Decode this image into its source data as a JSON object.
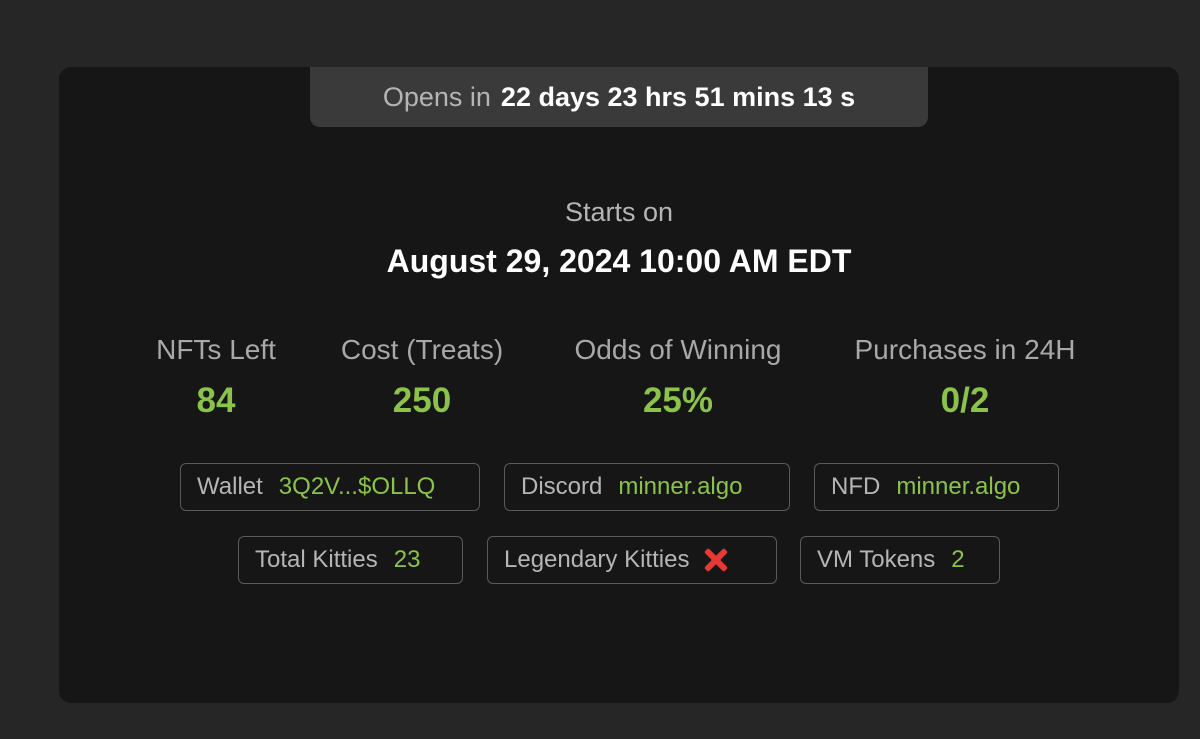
{
  "countdown": {
    "prefix": "Opens in",
    "time": "22 days 23 hrs 51 mins 13 s"
  },
  "start": {
    "label": "Starts on",
    "date": "August 29, 2024 10:00 AM EDT"
  },
  "stats": [
    {
      "label": "NFTs Left",
      "value": "84"
    },
    {
      "label": "Cost (Treats)",
      "value": "250"
    },
    {
      "label": "Odds of Winning",
      "value": "25%"
    },
    {
      "label": "Purchases in 24H",
      "value": "0/2"
    }
  ],
  "chips": {
    "wallet": {
      "label": "Wallet",
      "value": "3Q2V...$OLLQ"
    },
    "discord": {
      "label": "Discord",
      "value": "minner.algo"
    },
    "nfd": {
      "label": "NFD",
      "value": "minner.algo"
    },
    "total_kitties": {
      "label": "Total Kitties",
      "value": "23"
    },
    "legendary_kitties": {
      "label": "Legendary Kitties",
      "icon": "cross-mark-icon"
    },
    "vm_tokens": {
      "label": "VM Tokens",
      "value": "2"
    }
  },
  "colors": {
    "accent_green": "#8bc34a",
    "cross_red": "#e53935",
    "card_bg": "#161616",
    "page_bg": "#262626"
  }
}
